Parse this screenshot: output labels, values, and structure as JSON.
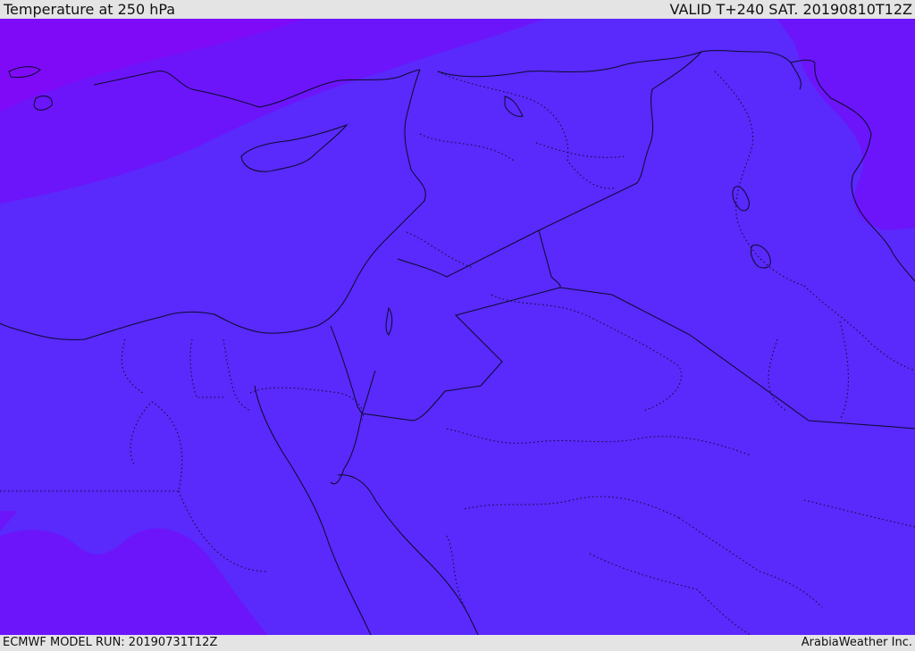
{
  "header": {
    "title": "Temperature at 250 hPa",
    "valid": "VALID T+240 SAT. 20190810T12Z"
  },
  "footer": {
    "model_run": "ECMWF MODEL RUN: 20190731T12Z",
    "credit": "ArabiaWeather Inc."
  },
  "colors": {
    "base_field": "#5a29fb",
    "cold_field": "#6c15fa",
    "coldest_field": "#7f0af8",
    "border": "#0a0a2a",
    "header_bg": "#e4e4e4"
  }
}
